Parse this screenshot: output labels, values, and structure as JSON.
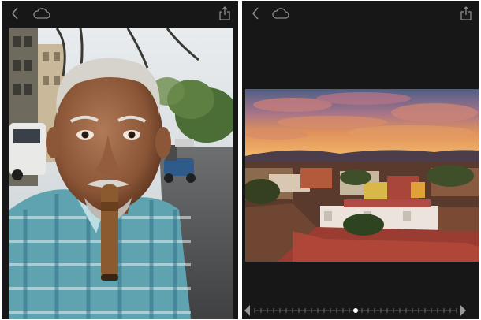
{
  "screens": [
    {
      "id": "left",
      "toolbar": {
        "back_icon": "chevron-left-icon",
        "cloud_icon": "cloud-icon",
        "share_icon": "share-icon"
      },
      "photo": {
        "subject": "portrait"
      }
    },
    {
      "id": "right",
      "toolbar": {
        "back_icon": "chevron-left-icon",
        "cloud_icon": "cloud-icon",
        "share_icon": "share-icon"
      },
      "photo": {
        "subject": "sunset-rooftops"
      },
      "scrubber": {
        "position_fraction": 0.5,
        "left_icon": "caret-left-icon",
        "right_icon": "caret-right-icon"
      }
    }
  ],
  "colors": {
    "background": "#171717",
    "icon": "#8c8c8c",
    "accent": "#ffffff"
  }
}
